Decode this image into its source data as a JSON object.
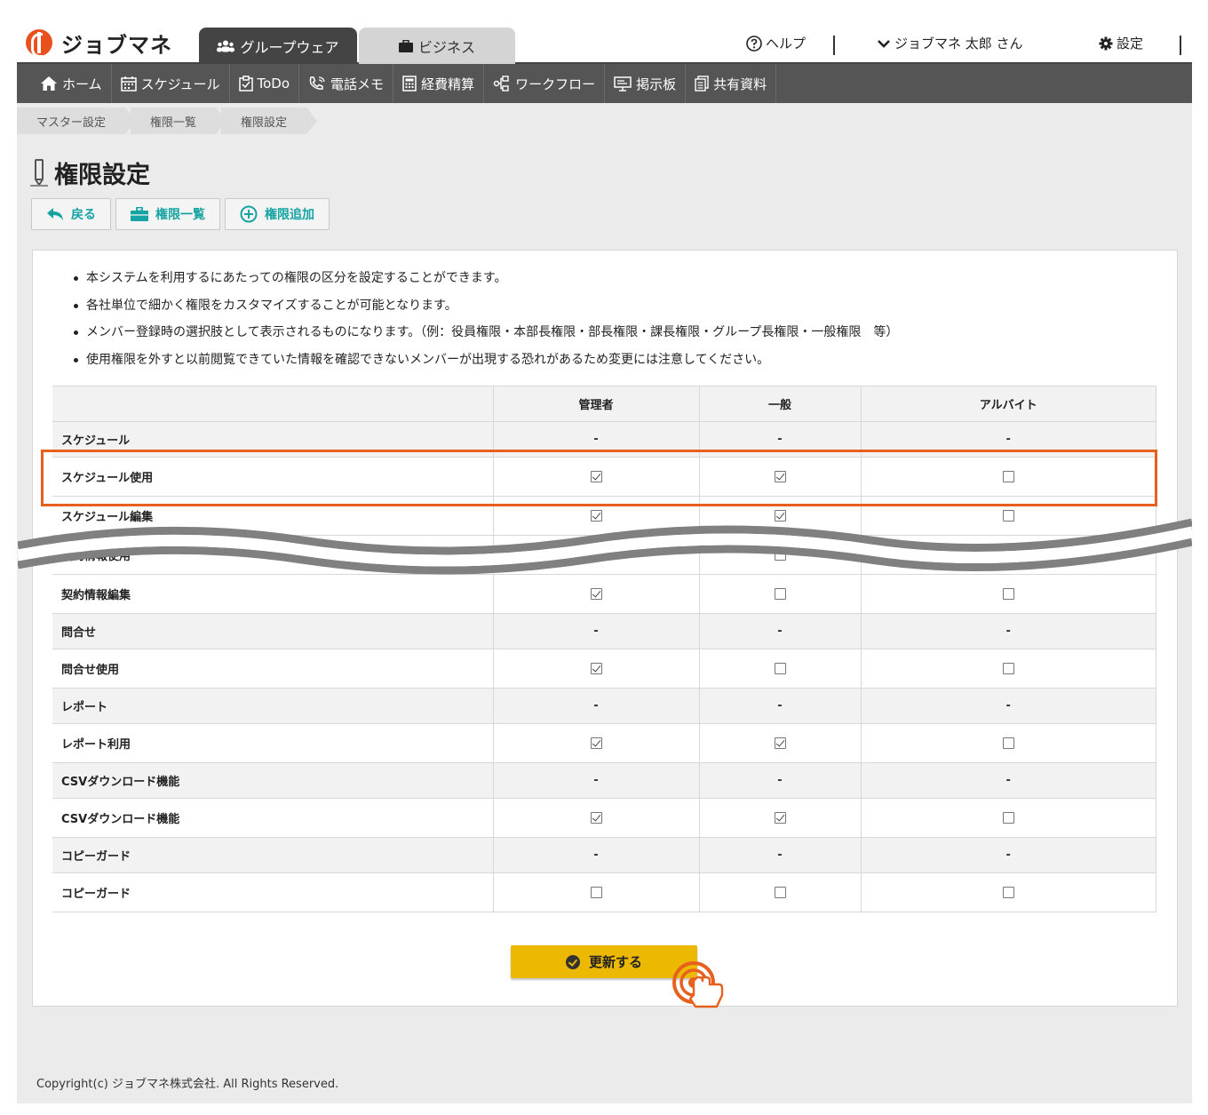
{
  "header": {
    "logo_text": "ジョブマネ",
    "tabs": [
      {
        "label": "グループウェア",
        "icon": "group-icon",
        "active": true
      },
      {
        "label": "ビジネス",
        "icon": "briefcase-icon",
        "active": false
      }
    ],
    "help_label": "ヘルプ",
    "user_label": "ジョブマネ 太郎 さん",
    "settings_label": "設定"
  },
  "nav": [
    {
      "label": "ホーム",
      "icon": "home-icon"
    },
    {
      "label": "スケジュール",
      "icon": "calendar-icon"
    },
    {
      "label": "ToDo",
      "icon": "clipboard-icon"
    },
    {
      "label": "電話メモ",
      "icon": "phone-icon"
    },
    {
      "label": "経費精算",
      "icon": "calculator-icon"
    },
    {
      "label": "ワークフロー",
      "icon": "workflow-icon"
    },
    {
      "label": "掲示板",
      "icon": "board-icon"
    },
    {
      "label": "共有資料",
      "icon": "document-icon"
    }
  ],
  "breadcrumb": [
    "マスター設定",
    "権限一覧",
    "権限設定"
  ],
  "page_title": "権限設定",
  "actions": {
    "back": "戻る",
    "list": "権限一覧",
    "add": "権限追加"
  },
  "notes": [
    "本システムを利用するにあたっての権限の区分を設定することができます。",
    "各社単位で細かく権限をカスタマイズすることが可能となります。",
    "メンバー登録時の選択肢として表示されるものになります。（例：役員権限・本部長権限・部長権限・課長権限・グループ長権限・一般権限　等）",
    "使用権限を外すと以前閲覧できていた情報を確認できないメンバーが出現する恐れがあるため変更には注意してください。"
  ],
  "table": {
    "columns": [
      "",
      "管理者",
      "一般",
      "アルバイト"
    ],
    "dash": "-",
    "rows": [
      {
        "label": "スケジュール",
        "type": "group"
      },
      {
        "label": "スケジュール使用",
        "type": "item",
        "values": [
          true,
          true,
          false
        ]
      },
      {
        "label": "スケジュール編集",
        "type": "item",
        "values": [
          true,
          true,
          false
        ]
      },
      {
        "label": "契約情報使用",
        "type": "item",
        "values": [
          true,
          false,
          false
        ]
      },
      {
        "label": "契約情報編集",
        "type": "item",
        "values": [
          true,
          false,
          false
        ]
      },
      {
        "label": "問合せ",
        "type": "group"
      },
      {
        "label": "問合せ使用",
        "type": "item",
        "values": [
          true,
          false,
          false
        ]
      },
      {
        "label": "レポート",
        "type": "group"
      },
      {
        "label": "レポート利用",
        "type": "item",
        "values": [
          true,
          true,
          false
        ]
      },
      {
        "label": "CSVダウンロード機能",
        "type": "group"
      },
      {
        "label": "CSVダウンロード機能",
        "type": "item",
        "values": [
          true,
          true,
          false
        ]
      },
      {
        "label": "コピーガード",
        "type": "group"
      },
      {
        "label": "コピーガード",
        "type": "item",
        "values": [
          false,
          false,
          false
        ]
      }
    ]
  },
  "submit_label": "更新する",
  "copyright": "Copyright(c) ジョブマネ株式会社. All Rights Reserved.",
  "colors": {
    "accent_teal": "#16a3a3",
    "nav_bg": "#555555",
    "highlight": "#e6601e",
    "submit_bg": "#ecb800",
    "logo": "#e8501e"
  }
}
